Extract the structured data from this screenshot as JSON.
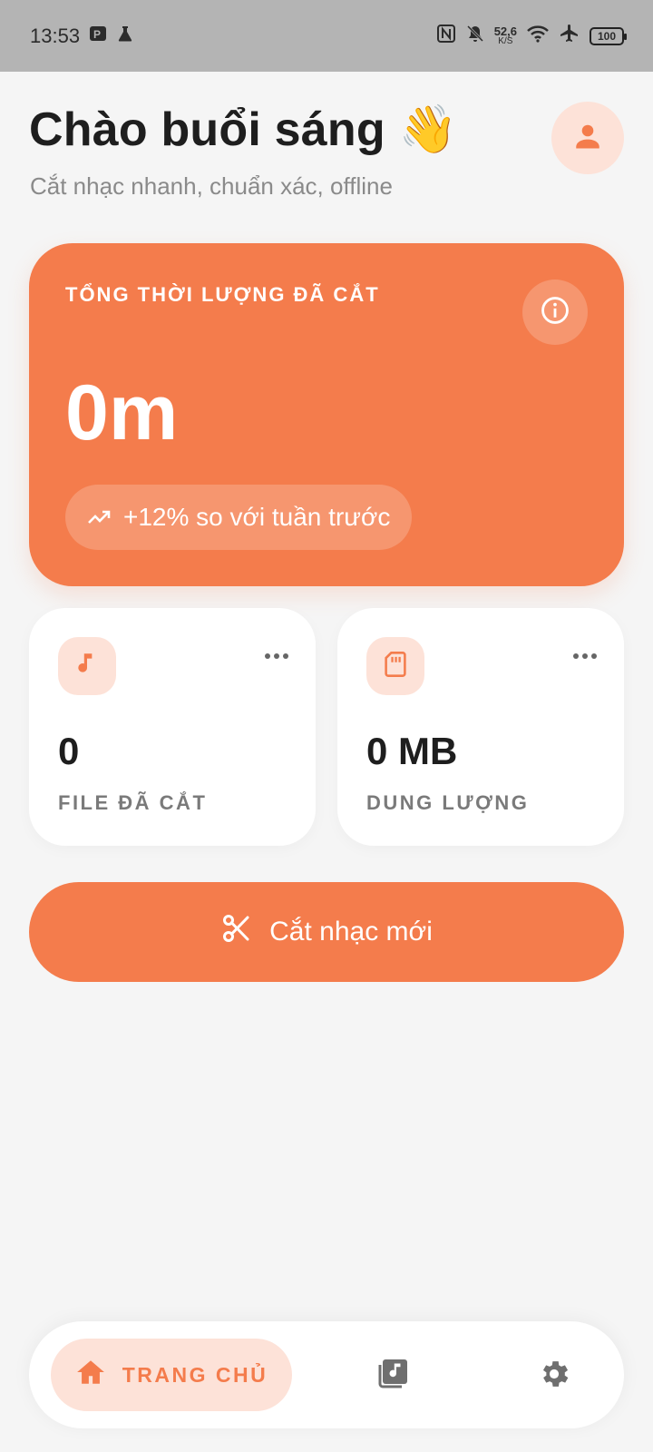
{
  "status_bar": {
    "time": "13:53",
    "net_speed_value": "52,6",
    "net_speed_unit": "K/S",
    "battery": "100"
  },
  "header": {
    "greeting": "Chào buổi sáng 👋",
    "subtitle": "Cắt nhạc nhanh, chuẩn xác, offline"
  },
  "hero_card": {
    "label": "TỔNG THỜI LƯỢNG ĐÃ CẮT",
    "value": "0m",
    "trend": "+12% so với tuần trước"
  },
  "stats": {
    "files": {
      "value": "0",
      "label": "FILE ĐÃ CẮT"
    },
    "storage": {
      "value": "0 MB",
      "label": "DUNG LƯỢNG"
    }
  },
  "cta": {
    "label": "Cắt nhạc mới"
  },
  "bottom_nav": {
    "home_label": "TRANG CHỦ"
  },
  "colors": {
    "accent": "#f47c4c",
    "accent_soft": "#fde2d8",
    "background": "#f5f5f5"
  }
}
